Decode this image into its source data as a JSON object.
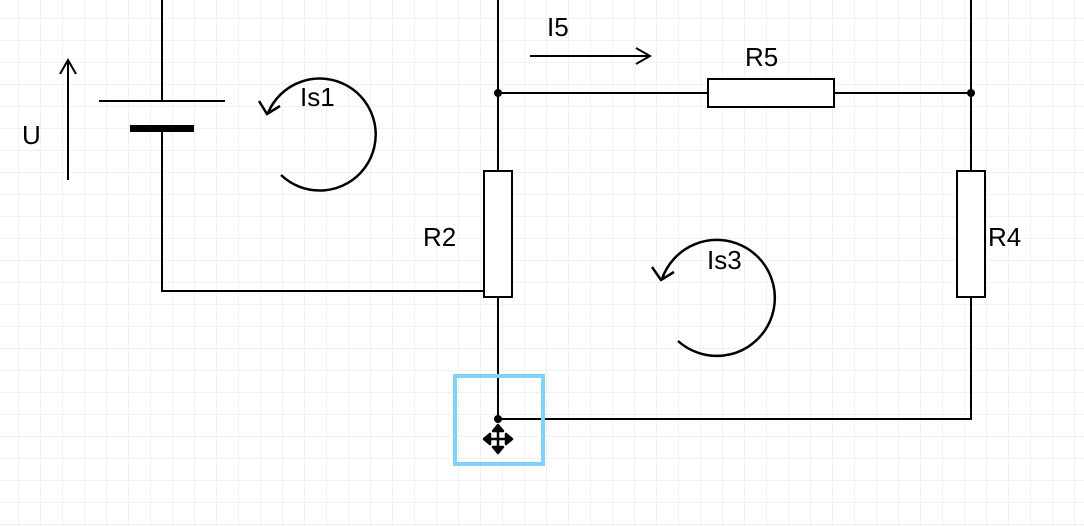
{
  "labels": {
    "U": "U",
    "Is1": "Is1",
    "Is3": "Is3",
    "I5": "I5",
    "R2": "R2",
    "R4": "R4",
    "R5": "R5"
  },
  "selection": {
    "active": true
  }
}
